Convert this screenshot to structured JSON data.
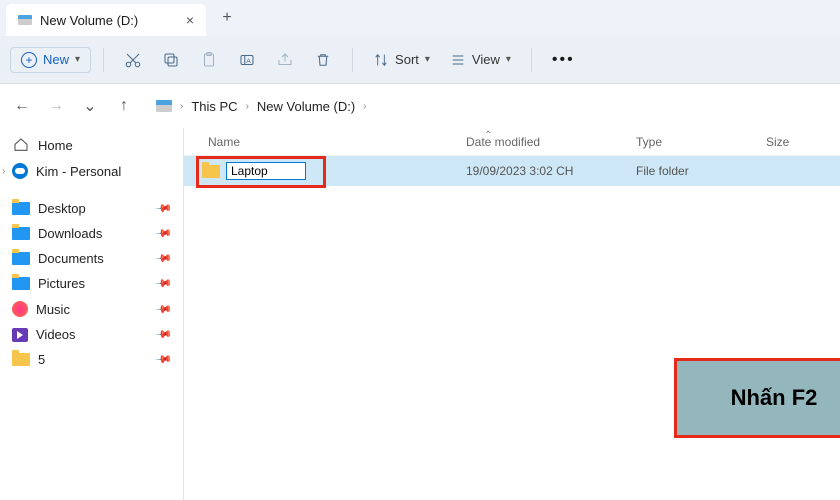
{
  "tab": {
    "title": "New Volume (D:)"
  },
  "toolbar": {
    "new_label": "New",
    "sort_label": "Sort",
    "view_label": "View"
  },
  "breadcrumb": {
    "root": "This PC",
    "drive": "New Volume (D:)"
  },
  "columns": {
    "name": "Name",
    "date": "Date modified",
    "type": "Type",
    "size": "Size"
  },
  "sidebar": {
    "home": "Home",
    "personal": "Kim - Personal",
    "desktop": "Desktop",
    "downloads": "Downloads",
    "documents": "Documents",
    "pictures": "Pictures",
    "music": "Music",
    "videos": "Videos",
    "five": "5"
  },
  "row": {
    "rename_value": "Laptop",
    "date": "19/09/2023 3:02 CH",
    "type": "File folder",
    "size": ""
  },
  "callout": {
    "text": "Nhấn F2"
  }
}
